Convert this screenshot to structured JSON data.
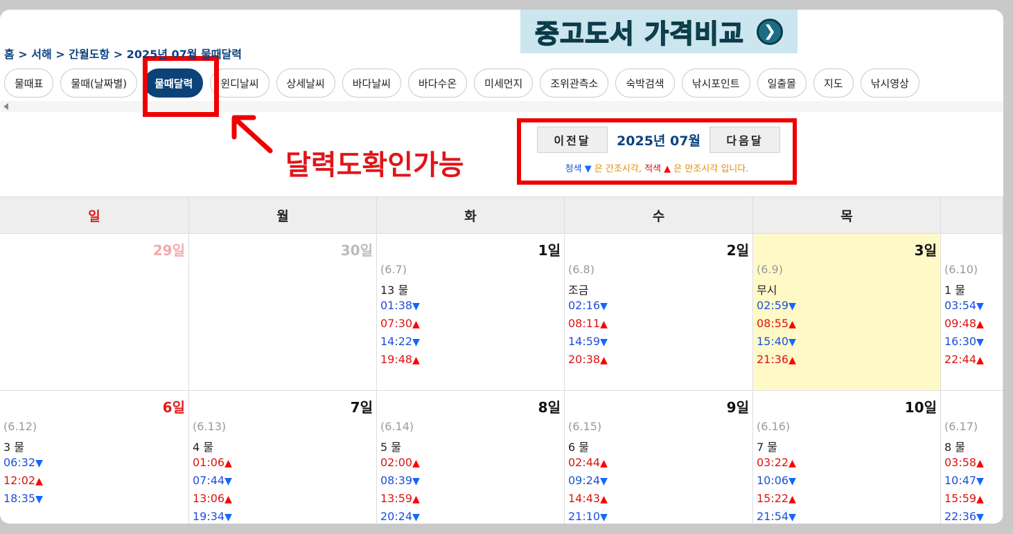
{
  "banner": {
    "text": "중고도서 가격비교",
    "arrow": "❯"
  },
  "breadcrumb": "홈 > 서해 > 간월도항 > 2025년 07월 물때달력",
  "nav": {
    "items": [
      "물때표",
      "물때(날짜별)",
      "물때달력",
      "윈디날씨",
      "상세날씨",
      "바다날씨",
      "바다수온",
      "미세먼지",
      "조위관측소",
      "숙박검색",
      "낚시포인트",
      "일출몰",
      "지도",
      "낚시영상"
    ],
    "active_index": 2
  },
  "annotation": "달력도확인가능",
  "month_nav": {
    "prev": "이전달",
    "title": "2025년 07월",
    "next": "다음달"
  },
  "legend": {
    "blue_word": "청색",
    "down_symbol": "▼",
    "text1": " 은 간조시각, ",
    "red_word": "적색",
    "up_symbol": "▲",
    "text2": " 은 만조시각 입니다."
  },
  "colors": {
    "low": "#1d4ed8",
    "high": "#dd1111",
    "highlight": "#fff9c7",
    "accent": "#0b4277",
    "annotation": "#e0151a"
  },
  "weekdays": [
    "일",
    "월",
    "화",
    "수",
    "목",
    ""
  ],
  "rows": [
    [
      {
        "date": "29일",
        "type": "faint-sun",
        "lunar": "",
        "tide": "",
        "times": []
      },
      {
        "date": "30일",
        "type": "faint",
        "lunar": "",
        "tide": "",
        "times": []
      },
      {
        "date": "1일",
        "type": "normal",
        "lunar": "(6.7)",
        "tide": "13 물",
        "times": [
          {
            "t": "01:38",
            "k": "low"
          },
          {
            "t": "07:30",
            "k": "high"
          },
          {
            "t": "14:22",
            "k": "low"
          },
          {
            "t": "19:48",
            "k": "high"
          }
        ]
      },
      {
        "date": "2일",
        "type": "normal",
        "lunar": "(6.8)",
        "tide": "조금",
        "times": [
          {
            "t": "02:16",
            "k": "low"
          },
          {
            "t": "08:11",
            "k": "high"
          },
          {
            "t": "14:59",
            "k": "low"
          },
          {
            "t": "20:38",
            "k": "high"
          }
        ]
      },
      {
        "date": "3일",
        "type": "normal",
        "hl": true,
        "lunar": "(6.9)",
        "tide": "무시",
        "times": [
          {
            "t": "02:59",
            "k": "low"
          },
          {
            "t": "08:55",
            "k": "high"
          },
          {
            "t": "15:40",
            "k": "low"
          },
          {
            "t": "21:36",
            "k": "high"
          }
        ]
      },
      {
        "date": "",
        "type": "normal",
        "lunar": "(6.10)",
        "tide": "1 물",
        "times": [
          {
            "t": "03:54",
            "k": "low"
          },
          {
            "t": "09:48",
            "k": "high"
          },
          {
            "t": "16:30",
            "k": "low"
          },
          {
            "t": "22:44",
            "k": "high"
          }
        ]
      }
    ],
    [
      {
        "date": "6일",
        "type": "sun",
        "lunar": "(6.12)",
        "tide": "3 물",
        "times": [
          {
            "t": "06:32",
            "k": "low"
          },
          {
            "t": "12:02",
            "k": "high"
          },
          {
            "t": "18:35",
            "k": "low"
          }
        ]
      },
      {
        "date": "7일",
        "type": "normal",
        "lunar": "(6.13)",
        "tide": "4 물",
        "times": [
          {
            "t": "01:06",
            "k": "high"
          },
          {
            "t": "07:44",
            "k": "low"
          },
          {
            "t": "13:06",
            "k": "high"
          },
          {
            "t": "19:34",
            "k": "low"
          }
        ]
      },
      {
        "date": "8일",
        "type": "normal",
        "lunar": "(6.14)",
        "tide": "5 물",
        "times": [
          {
            "t": "02:00",
            "k": "high"
          },
          {
            "t": "08:39",
            "k": "low"
          },
          {
            "t": "13:59",
            "k": "high"
          },
          {
            "t": "20:24",
            "k": "low"
          }
        ]
      },
      {
        "date": "9일",
        "type": "normal",
        "lunar": "(6.15)",
        "tide": "6 물",
        "times": [
          {
            "t": "02:44",
            "k": "high"
          },
          {
            "t": "09:24",
            "k": "low"
          },
          {
            "t": "14:43",
            "k": "high"
          },
          {
            "t": "21:10",
            "k": "low"
          }
        ]
      },
      {
        "date": "10일",
        "type": "normal",
        "lunar": "(6.16)",
        "tide": "7 물",
        "times": [
          {
            "t": "03:22",
            "k": "high"
          },
          {
            "t": "10:06",
            "k": "low"
          },
          {
            "t": "15:22",
            "k": "high"
          },
          {
            "t": "21:54",
            "k": "low"
          }
        ]
      },
      {
        "date": "",
        "type": "normal",
        "lunar": "(6.17)",
        "tide": "8 물",
        "times": [
          {
            "t": "03:58",
            "k": "high"
          },
          {
            "t": "10:47",
            "k": "low"
          },
          {
            "t": "15:59",
            "k": "high"
          },
          {
            "t": "22:36",
            "k": "low"
          }
        ]
      }
    ]
  ]
}
